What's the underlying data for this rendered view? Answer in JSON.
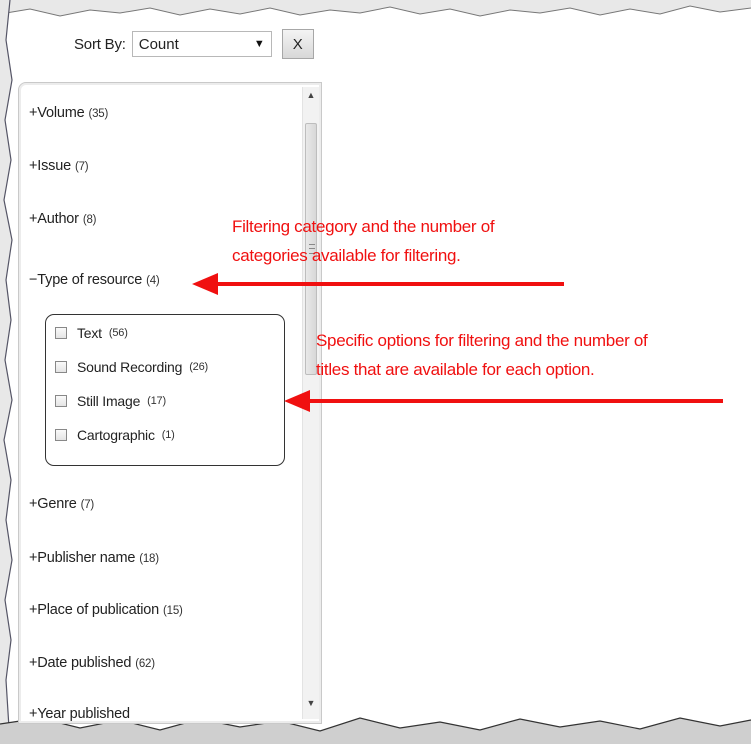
{
  "sort": {
    "label": "Sort By:",
    "selected": "Count",
    "clear_label": "X"
  },
  "facets": [
    {
      "prefix": "+",
      "label": "Volume",
      "count": "(35)"
    },
    {
      "prefix": "+",
      "label": "Issue",
      "count": "(7)"
    },
    {
      "prefix": "+",
      "label": "Author",
      "count": "(8)"
    },
    {
      "prefix": "−",
      "label": "Type of resource",
      "count": "(4)"
    },
    {
      "prefix": "+",
      "label": "Genre",
      "count": "(7)"
    },
    {
      "prefix": "+",
      "label": "Publisher name",
      "count": "(18)"
    },
    {
      "prefix": "+",
      "label": "Place of publication",
      "count": "(15)"
    },
    {
      "prefix": "+",
      "label": "Date published",
      "count": "(62)"
    },
    {
      "prefix": "+",
      "label": "Year published",
      "count": ""
    }
  ],
  "options": [
    {
      "label": "Text",
      "count": "(56)"
    },
    {
      "label": "Sound Recording",
      "count": "(26)"
    },
    {
      "label": "Still Image",
      "count": "(17)"
    },
    {
      "label": "Cartographic",
      "count": "(1)"
    }
  ],
  "annotations": {
    "category_line1": "Filtering category and the number of",
    "category_line2": "categories available for filtering.",
    "options_line1": "Specific options for filtering and the number of",
    "options_line2": "titles that are available for each option.",
    "color": "#f01010"
  },
  "icons": {
    "scroll_up": "triangle-up",
    "scroll_down": "triangle-down",
    "dropdown": "triangle-down"
  }
}
